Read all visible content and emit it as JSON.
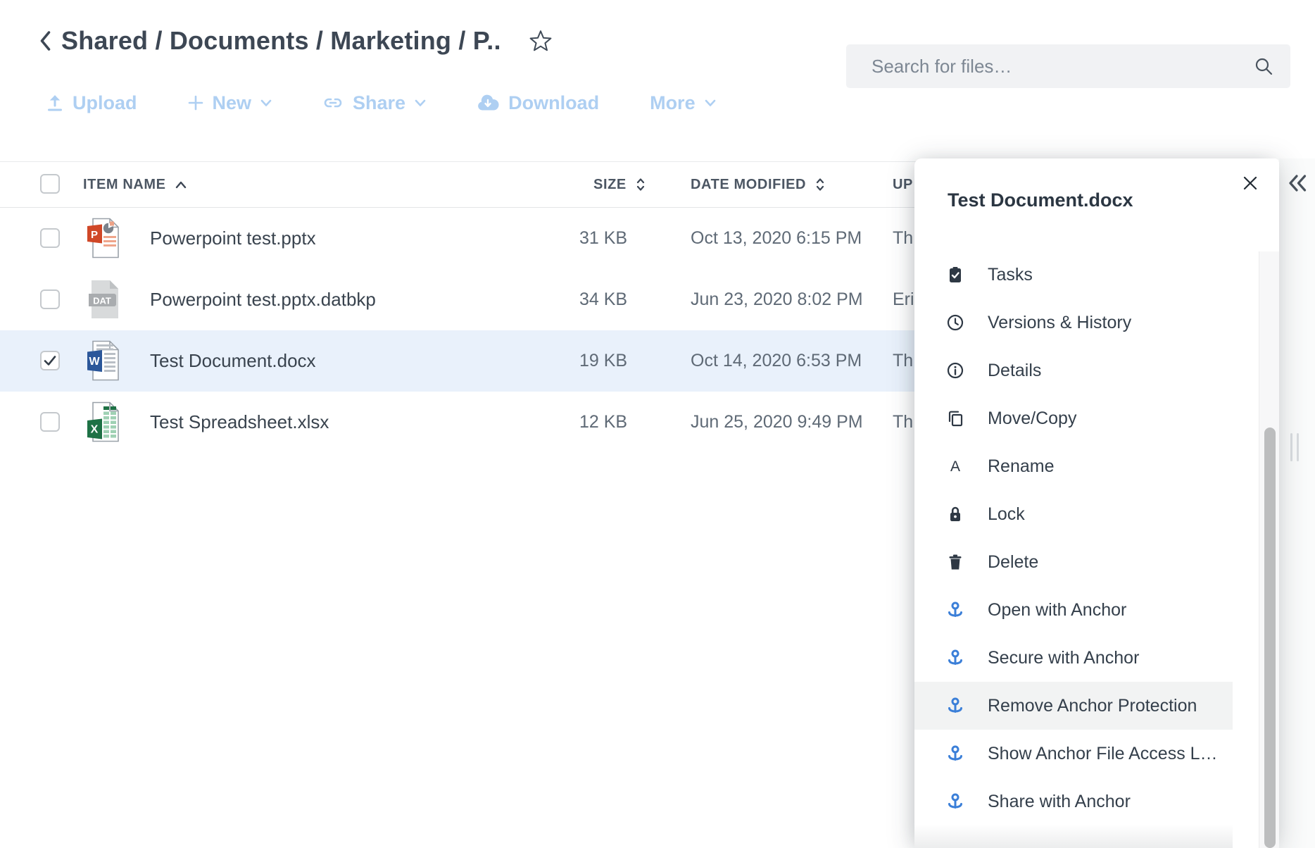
{
  "breadcrumb": {
    "path": "Shared / Documents / Marketing / P.."
  },
  "toolbar": {
    "upload_label": "Upload",
    "new_label": "New",
    "share_label": "Share",
    "download_label": "Download",
    "more_label": "More"
  },
  "search": {
    "placeholder": "Search for files…"
  },
  "table": {
    "headers": {
      "name": "ITEM NAME",
      "size": "SIZE",
      "modified": "DATE MODIFIED",
      "updated_by": "UP"
    },
    "rows": [
      {
        "name": "Powerpoint test.pptx",
        "size": "31 KB",
        "modified": "Oct 13, 2020 6:15 PM",
        "updated_by": "Th",
        "icon": "powerpoint-file-icon",
        "checked": false,
        "selected": false
      },
      {
        "name": "Powerpoint test.pptx.datbkp",
        "size": "34 KB",
        "modified": "Jun 23, 2020 8:02 PM",
        "updated_by": "Eri",
        "icon": "dat-backup-file-icon",
        "checked": false,
        "selected": false
      },
      {
        "name": "Test Document.docx",
        "size": "19 KB",
        "modified": "Oct 14, 2020 6:53 PM",
        "updated_by": "Th",
        "icon": "word-file-icon",
        "checked": true,
        "selected": true
      },
      {
        "name": "Test Spreadsheet.xlsx",
        "size": "12 KB",
        "modified": "Jun 25, 2020 9:49 PM",
        "updated_by": "Th",
        "icon": "excel-file-icon",
        "checked": false,
        "selected": false
      }
    ]
  },
  "panel": {
    "title": "Test Document.docx",
    "items": [
      {
        "label": "Tasks",
        "icon": "tasks-icon",
        "highlighted": false
      },
      {
        "label": "Versions & History",
        "icon": "clock-icon",
        "highlighted": false
      },
      {
        "label": "Details",
        "icon": "info-icon",
        "highlighted": false
      },
      {
        "label": "Move/Copy",
        "icon": "copy-icon",
        "highlighted": false
      },
      {
        "label": "Rename",
        "icon": "rename-icon",
        "highlighted": false
      },
      {
        "label": "Lock",
        "icon": "lock-icon",
        "highlighted": false
      },
      {
        "label": "Delete",
        "icon": "trash-icon",
        "highlighted": false
      },
      {
        "label": "Open with Anchor",
        "icon": "anchor-icon",
        "highlighted": false
      },
      {
        "label": "Secure with Anchor",
        "icon": "anchor-icon",
        "highlighted": false
      },
      {
        "label": "Remove Anchor Protection",
        "icon": "anchor-icon",
        "highlighted": true
      },
      {
        "label": "Show Anchor File Access L…",
        "icon": "anchor-icon",
        "highlighted": false
      },
      {
        "label": "Share with Anchor",
        "icon": "anchor-icon",
        "highlighted": false
      }
    ]
  },
  "colors": {
    "toolbar_disabled_blue": "#aecff2",
    "anchor_blue": "#3b7fd8",
    "selected_row_bg": "#e9f1fb",
    "menu_highlight_bg": "#f2f3f3",
    "word_blue": "#2b579a",
    "powerpoint_red": "#d04727",
    "excel_green": "#1e7145",
    "text_dark": "#39434e",
    "text_muted": "#5f6a76"
  }
}
